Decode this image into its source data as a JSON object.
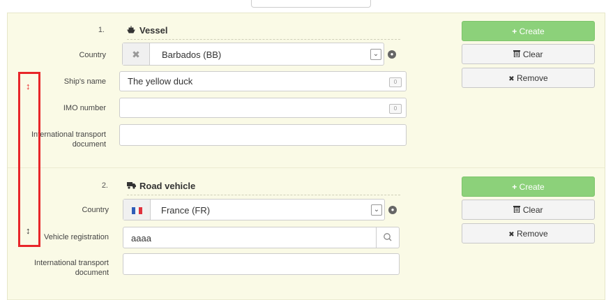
{
  "sections": [
    {
      "number": "1.",
      "title": "Vessel",
      "icon": "ship-icon",
      "country_label": "Country",
      "country_value": "Barbados (BB)",
      "ship_name_label": "Ship's name",
      "ship_name_value": "The yellow duck",
      "ship_name_counter": "0",
      "imo_label": "IMO number",
      "imo_value": "",
      "imo_counter": "0",
      "transport_doc_label_line1": "International transport",
      "transport_doc_label_line2": "document",
      "transport_doc_value": "",
      "create_label": "Create",
      "clear_label": "Clear",
      "remove_label": "Remove"
    },
    {
      "number": "2.",
      "title": "Road vehicle",
      "icon": "truck-icon",
      "country_label": "Country",
      "country_value": "France (FR)",
      "vehicle_reg_label": "Vehicle registration",
      "vehicle_reg_value": "aaaa",
      "transport_doc_label_line1": "International transport",
      "transport_doc_label_line2": "document",
      "transport_doc_value": "",
      "create_label": "Create",
      "clear_label": "Clear",
      "remove_label": "Remove"
    }
  ],
  "colors": {
    "create_button": "#8cd17a",
    "highlight": "#e8262a",
    "panel_background": "#fafae6"
  },
  "glyphs": {
    "plus": "+",
    "clear_x": "✖",
    "remove_x": "✖",
    "caret": "⌄",
    "search": "⌕",
    "resize": "↕"
  }
}
